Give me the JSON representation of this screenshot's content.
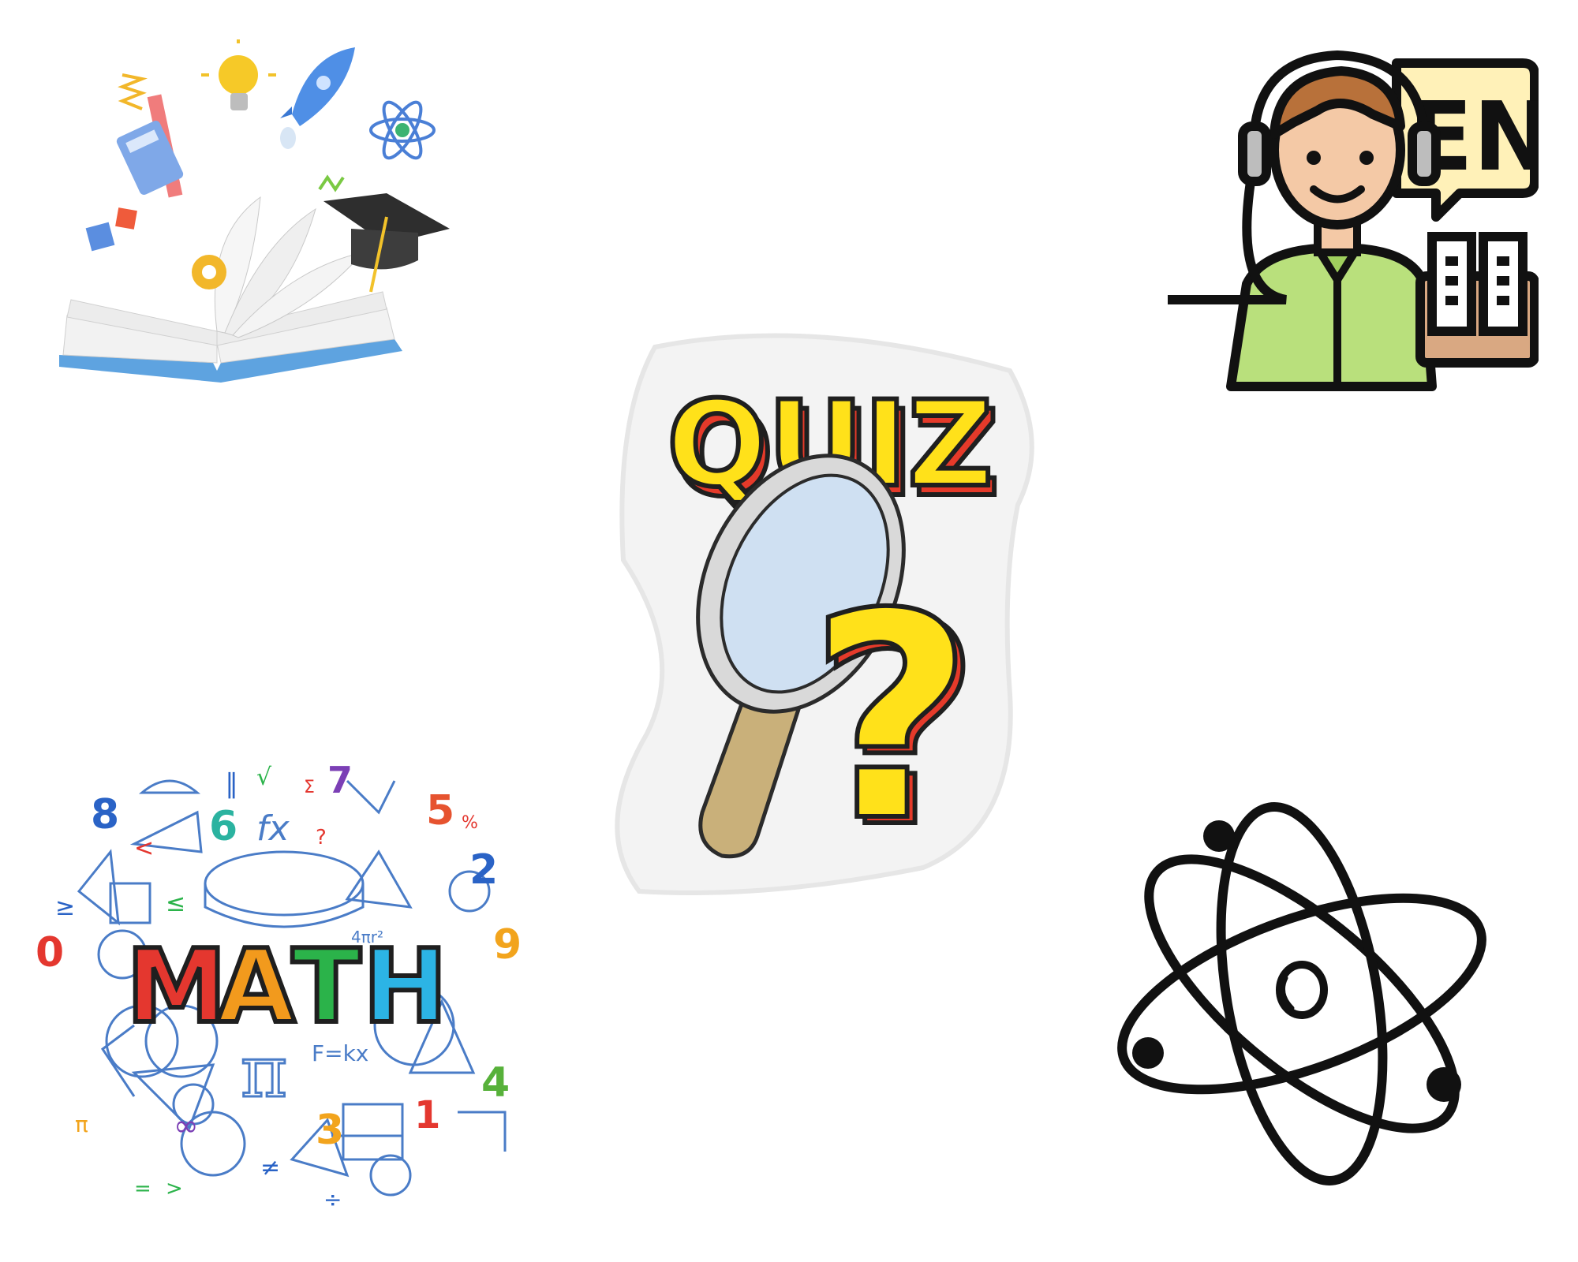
{
  "canvas": {
    "background": "#ffffff"
  },
  "stickers": {
    "quiz": {
      "word": "QUIZ",
      "fill": "#ffe11a",
      "shadow": "#e53a2a",
      "icons": [
        "magnifier-icon",
        "question-mark-icon"
      ]
    },
    "english": {
      "badge": "EN",
      "icons": [
        "headset-icon",
        "speech-bubble-icon",
        "book-icon"
      ],
      "shirt": "#b9e07c",
      "skin": "#f4c9a6",
      "hair": "#b8713a",
      "bubble": "#fff1b8"
    },
    "math": {
      "letters": [
        "M",
        "A",
        "T",
        "H"
      ],
      "letter_colors": [
        "#e4372f",
        "#f29a1d",
        "#2bb34a",
        "#2cb4e5"
      ],
      "numbers": [
        "8",
        "6",
        "7",
        "5",
        "2",
        "0",
        "9",
        "4",
        "3",
        "1"
      ],
      "symbols": [
        "∥",
        "√",
        "Σ",
        "%",
        "?",
        "<",
        "≥",
        "≤",
        "π",
        "∞",
        "≠",
        "÷",
        "=",
        ">",
        "fx",
        "F=kx",
        "4πr²"
      ]
    },
    "books": {
      "icons": [
        "open-book-icon",
        "light-bulb-icon",
        "rocket-icon",
        "atom-icon",
        "calculator-icon",
        "ruler-icon",
        "graduation-cap-icon",
        "gear-icon",
        "dice-icon"
      ]
    },
    "atom": {
      "icons": [
        "atom-outline-icon"
      ]
    }
  }
}
